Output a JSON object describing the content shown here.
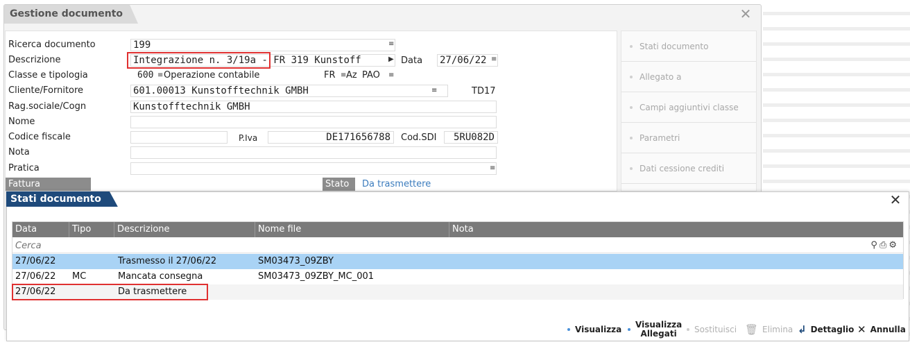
{
  "main": {
    "title": "Gestione documento",
    "close_glyph": "✕",
    "labels": {
      "ricerca": "Ricerca documento",
      "descrizione": "Descrizione",
      "classe": "Classe e tipologia",
      "cliente": "Cliente/Fornitore",
      "ragsoc": "Rag.sociale/Cogn",
      "nome": "Nome",
      "codfisc": "Codice fiscale",
      "nota": "Nota",
      "pratica": "Pratica",
      "fattura": "Fattura",
      "piva": "P.Iva",
      "codsdi": "Cod.SDI",
      "data": "Data",
      "stato": "Stato"
    },
    "values": {
      "ricerca": "199",
      "descrizione_highlight": "Integrazione n. 3/19a",
      "descrizione_rest": " - FR 319 Kunstoff",
      "data": "27/06/22",
      "classe_code": "600",
      "classe_desc": "Operazione contabile",
      "tipo_fr": "FR",
      "tipo_az": "Az",
      "tipo_pao": "PAO",
      "cliente": "601.00013 Kunstofftechnik GMBH",
      "td": "TD17",
      "ragsoc": "Kunstofftechnik GMBH",
      "nome": "",
      "codfisc": "",
      "piva": "DE171656788",
      "codsdi": "5RU082D",
      "nota": "",
      "pratica": "",
      "stato": "Da trasmettere"
    }
  },
  "side_menu": [
    "Stati documento",
    "Allegato a",
    "Campi aggiuntivi classe",
    "Parametri",
    "Dati cessione crediti"
  ],
  "dialog": {
    "title": "Stati documento",
    "columns": [
      "Data",
      "Tipo",
      "Descrizione",
      "Nome file",
      "Nota"
    ],
    "search_placeholder": "Cerca",
    "rows": [
      {
        "data": "27/06/22",
        "tipo": "",
        "descrizione": "Trasmesso il 27/06/22",
        "nome_file": "SM03473_09ZBY",
        "nota": ""
      },
      {
        "data": "27/06/22",
        "tipo": "MC",
        "descrizione": "Mancata consegna",
        "nome_file": "SM03473_09ZBY_MC_001",
        "nota": ""
      },
      {
        "data": "27/06/22",
        "tipo": "",
        "descrizione": "Da trasmettere",
        "nome_file": "",
        "nota": ""
      }
    ],
    "toolbar": {
      "visualizza": "Visualizza",
      "visualizza_allegati_1": "Visualizza",
      "visualizza_allegati_2": "Allegati",
      "sostituisci": "Sostituisci",
      "elimina": "Elimina",
      "dettaglio": "Dettaglio",
      "annulla": "Annulla"
    }
  },
  "colors": {
    "dialog_tab": "#1e4a7b",
    "selected_row": "#a9d3f5",
    "highlight_box": "#e03030",
    "stato_value": "#3a7bbd"
  }
}
